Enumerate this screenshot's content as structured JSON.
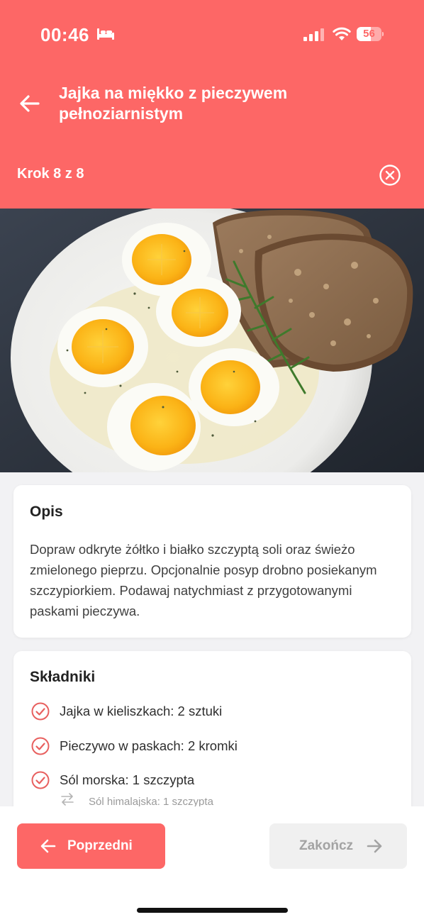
{
  "status_bar": {
    "time": "00:46",
    "battery_level": 56,
    "battery_text": "56",
    "icons": [
      "bed-icon",
      "signal-icon",
      "wifi-icon",
      "battery-icon"
    ]
  },
  "header": {
    "title": "Jajka na miękko z pieczywem pełnoziarnistym",
    "step": "Krok 8 z 8",
    "back_icon": "arrow-left-icon",
    "close_icon": "close-circle-icon",
    "background_color": "#fd6766"
  },
  "description": {
    "title": "Opis",
    "text": "Dopraw odkryte żółtko i białko szczyptą soli oraz świeżo zmielonego pieprzu. Opcjonalnie posyp drobno posiekanym szczypiorkiem. Podawaj natychmiast z przygotowanymi paskami pieczywa."
  },
  "ingredients": {
    "title": "Składniki",
    "items": [
      {
        "label": "Jajka w kieliszkach: 2 sztuki",
        "checked": true
      },
      {
        "label": "Pieczywo w paskach: 2 kromki",
        "checked": true
      },
      {
        "label": "Sól morska: 1 szczypta",
        "checked": true
      }
    ],
    "substitute": {
      "label": "Sól himalajska: 1 szczypta",
      "icon": "swap-icon"
    }
  },
  "navigation": {
    "prev_label": "Poprzedni",
    "finish_label": "Zakończ",
    "accent_color": "#fd6766"
  }
}
